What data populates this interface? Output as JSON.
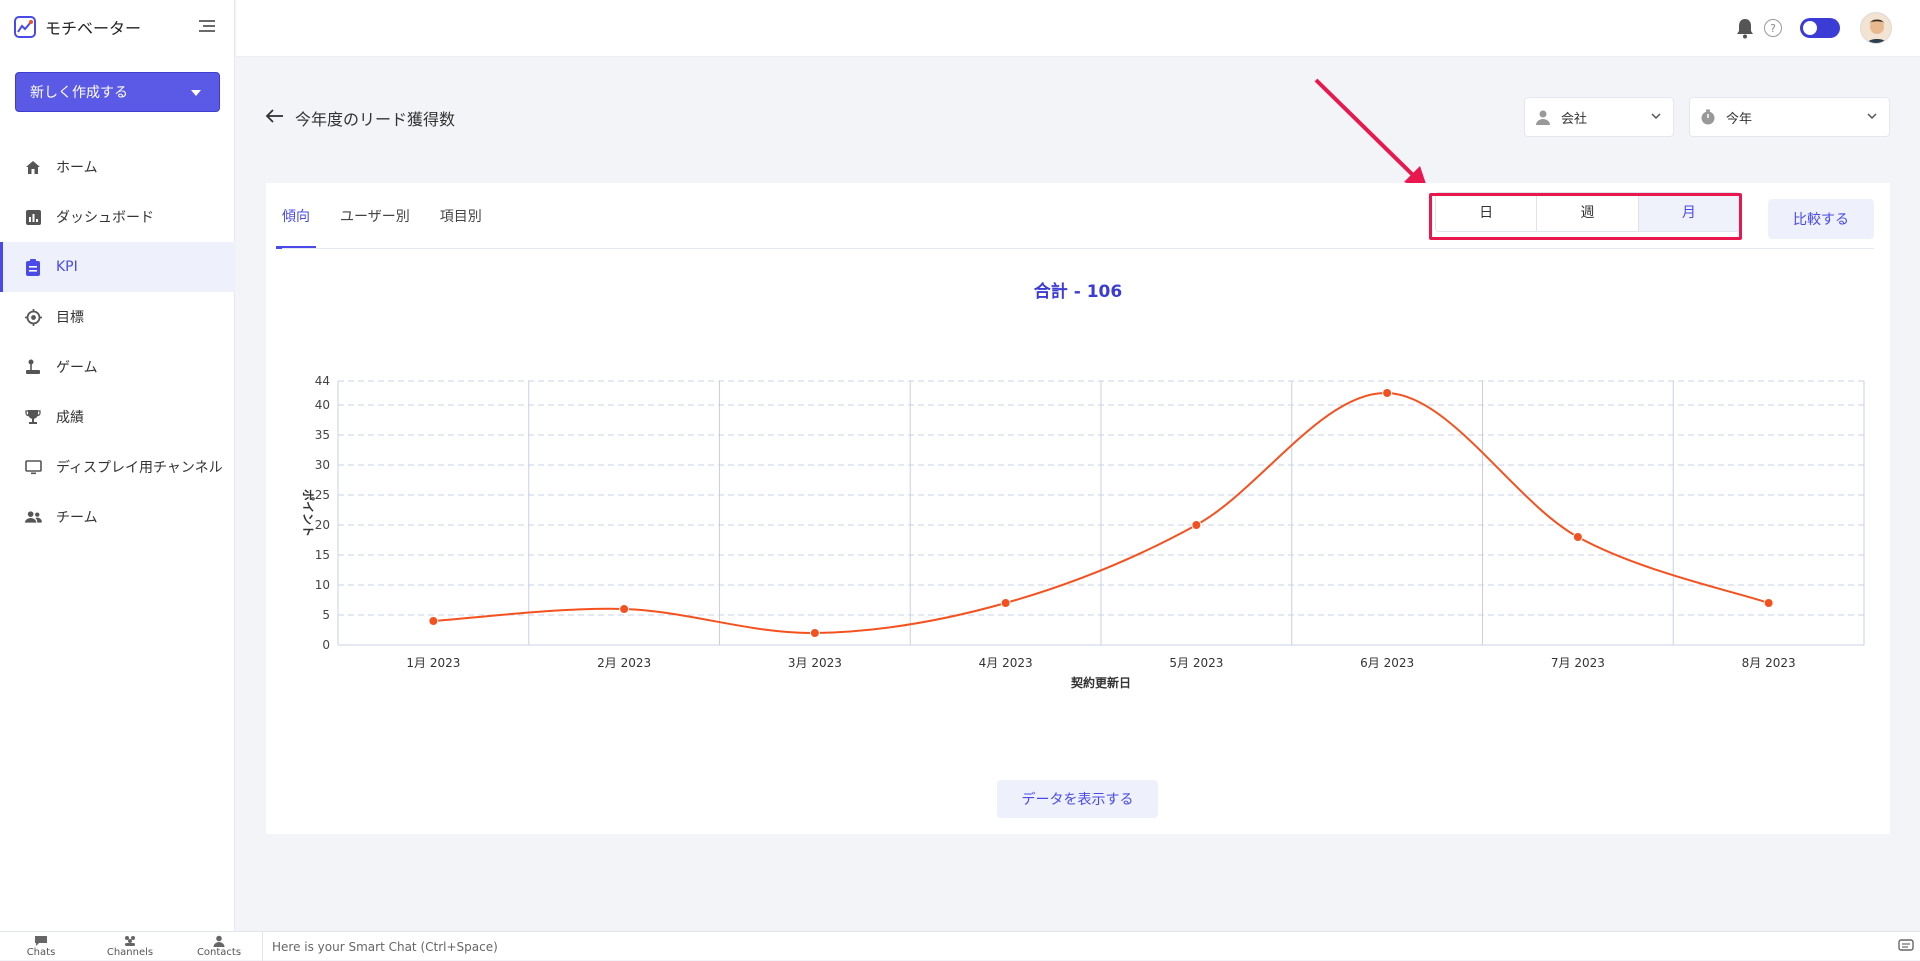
{
  "app": {
    "name": "モチベーター"
  },
  "sidebar": {
    "create_label": "新しく作成する",
    "items": [
      {
        "label": "ホーム",
        "icon": "home-icon"
      },
      {
        "label": "ダッシュボード",
        "icon": "dashboard-icon"
      },
      {
        "label": "KPI",
        "icon": "kpi-icon",
        "active": true
      },
      {
        "label": "目標",
        "icon": "target-icon"
      },
      {
        "label": "ゲーム",
        "icon": "joystick-icon"
      },
      {
        "label": "成績",
        "icon": "trophy-icon"
      },
      {
        "label": "ディスプレイ用チャンネル",
        "icon": "monitor-icon"
      },
      {
        "label": "チーム",
        "icon": "team-icon"
      }
    ]
  },
  "header": {
    "help_label": "?"
  },
  "page": {
    "title": "今年度のリード獲得数",
    "filters": {
      "company": "会社",
      "period": "今年"
    }
  },
  "tabs": [
    {
      "label": "傾向",
      "active": true
    },
    {
      "label": "ユーザー別"
    },
    {
      "label": "項目別"
    }
  ],
  "period_buttons": [
    {
      "label": "日"
    },
    {
      "label": "週"
    },
    {
      "label": "月",
      "active": true
    }
  ],
  "compare_label": "比較する",
  "total_label": "合計 - 106",
  "show_data_label": "データを表示する",
  "chart_data": {
    "type": "line",
    "categories": [
      "1月 2023",
      "2月 2023",
      "3月 2023",
      "4月 2023",
      "5月 2023",
      "6月 2023",
      "7月 2023",
      "8月 2023"
    ],
    "values": [
      4,
      6,
      2,
      7,
      20,
      42,
      18,
      7
    ],
    "ylim": [
      0,
      44
    ],
    "yticks": [
      0,
      5,
      10,
      15,
      20,
      25,
      30,
      35,
      40,
      44
    ],
    "xlabel": "契約更新日",
    "ylabel": "ポイント",
    "color": "#f4511e",
    "grid": true
  },
  "bottombar": {
    "chats": "Chats",
    "channels": "Channels",
    "contacts": "Contacts",
    "smart_chat_placeholder": "Here is your Smart Chat (Ctrl+Space)"
  },
  "colors": {
    "accent": "#4a4ae8",
    "highlight": "#e8174d",
    "line": "#f4511e"
  }
}
